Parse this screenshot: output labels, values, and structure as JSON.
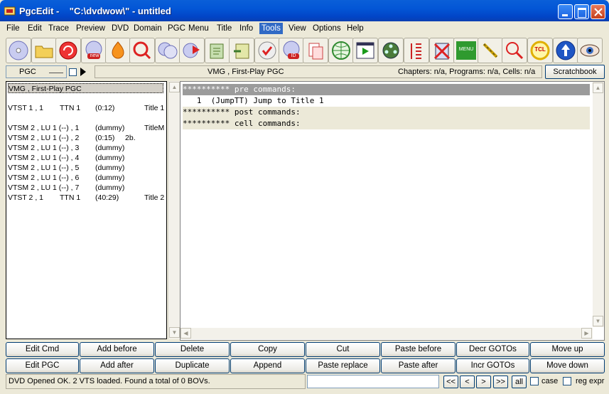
{
  "window": {
    "title": "PgcEdit -    \"C:\\dvdwow\\\" - untitled"
  },
  "menu": [
    "File",
    "Edit",
    "Trace",
    "Preview",
    "DVD",
    "Domain",
    "PGC",
    "Menu",
    "Title",
    "Info",
    "Tools",
    "View",
    "Options",
    "Help"
  ],
  "menu_active": "Tools",
  "toolbar": {
    "icons": [
      "open-disc-icon",
      "open-folder-icon",
      "reload-icon",
      "new-disc-icon",
      "burn-icon",
      "search-disc-icon",
      "copy-disc-icon",
      "jump-disc-icon",
      "export-icon",
      "import-icon",
      "check-disc-icon",
      "id-disc-icon",
      "copy-file-icon",
      "globe-icon",
      "play-preview-icon",
      "film-reel-icon",
      "list-icon",
      "delete-pgc-icon",
      "menu-icon",
      "link-icon",
      "numbers-search-icon",
      "tcl-icon",
      "navigate-icon",
      "eye-icon"
    ],
    "menu_icon_label": "MENU",
    "tcl_icon_label": "TCL",
    "new_icon_label": "new",
    "id_icon_label": "ID"
  },
  "controls": {
    "pgc_select": "PGC",
    "info_pgc": "VMG , First-Play PGC",
    "info_counts": "Chapters: n/a,  Programs: n/a,  Cells: n/a",
    "scratchbook": "Scratchbook"
  },
  "pgc_list": [
    {
      "c1": "VMG , First-Play PGC",
      "c2": "",
      "c3": "",
      "c4": "",
      "selected": true
    },
    {
      "c1": "",
      "c2": "",
      "c3": "",
      "c4": ""
    },
    {
      "c1": "VTST 1 , 1",
      "c2": "TTN 1",
      "c3": "(0:12)",
      "c4": "Title 1"
    },
    {
      "c1": "",
      "c2": "",
      "c3": "",
      "c4": ""
    },
    {
      "c1": "VTSM 2 , LU 1 (--) , 1",
      "c2": "",
      "c3": "(dummy)",
      "c4": "TitleM"
    },
    {
      "c1": "VTSM 2 , LU 1 (--) , 2",
      "c2": "",
      "c3": "(0:15)     2b.",
      "c4": ""
    },
    {
      "c1": "VTSM 2 , LU 1 (--) , 3",
      "c2": "",
      "c3": "(dummy)",
      "c4": ""
    },
    {
      "c1": "VTSM 2 , LU 1 (--) , 4",
      "c2": "",
      "c3": "(dummy)",
      "c4": ""
    },
    {
      "c1": "VTSM 2 , LU 1 (--) , 5",
      "c2": "",
      "c3": "(dummy)",
      "c4": ""
    },
    {
      "c1": "VTSM 2 , LU 1 (--) , 6",
      "c2": "",
      "c3": "(dummy)",
      "c4": ""
    },
    {
      "c1": "VTSM 2 , LU 1 (--) , 7",
      "c2": "",
      "c3": "(dummy)",
      "c4": ""
    },
    {
      "c1": "VTST 2 , 1",
      "c2": "TTN 1",
      "c3": "(40:29)",
      "c4": "Title 2"
    }
  ],
  "commands": [
    {
      "text": "********** pre commands:",
      "style": "header-dark"
    },
    {
      "text": "   1  (JumpTT) Jump to Title 1",
      "style": "plain"
    },
    {
      "text": "********** post commands:",
      "style": "header-light"
    },
    {
      "text": "********** cell commands:",
      "style": "header-light"
    }
  ],
  "buttons_row1": [
    "Edit Cmd",
    "Add before",
    "Delete",
    "Copy",
    "Cut",
    "Paste before",
    "Decr GOTOs",
    "Move up"
  ],
  "buttons_row2": [
    "Edit PGC",
    "Add after",
    "Duplicate",
    "Append",
    "Paste replace",
    "Paste after",
    "Incr GOTOs",
    "Move down"
  ],
  "status": {
    "text": "DVD Opened OK.  2 VTS loaded.   Found a total of 0 BOVs.",
    "search_value": "",
    "nav": [
      "<<",
      "<",
      ">",
      ">>",
      "all"
    ],
    "case_label": "case",
    "regexpr_label": "reg expr"
  },
  "colors": {
    "titlebar": "#0356d6",
    "menu_active": "#316ac5",
    "cmd_header_dark": "#9b9b9b",
    "cmd_header_light": "#ece9d8"
  }
}
